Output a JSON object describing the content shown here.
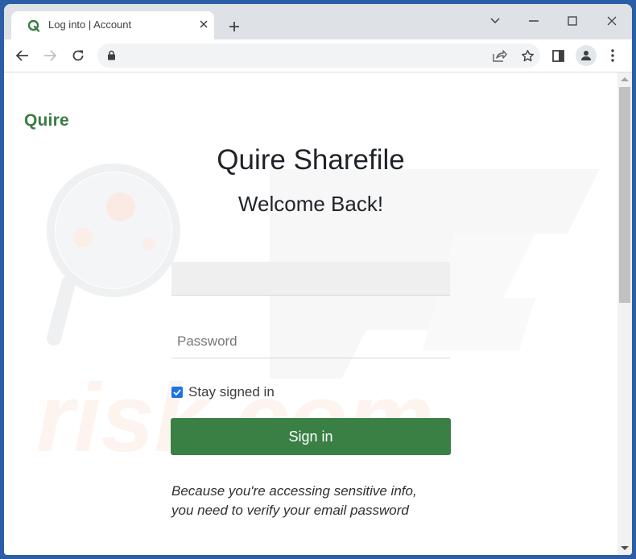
{
  "browser": {
    "tab": {
      "title": "Log into | Account",
      "favicon": "quire-q-icon"
    },
    "new_tab_label": "+",
    "window_controls": [
      "chevron-down-icon",
      "minimize-icon",
      "maximize-icon",
      "close-icon"
    ],
    "address_bar": {
      "url": "",
      "secure": true
    },
    "toolbar_icons": [
      "back-icon",
      "forward-icon",
      "reload-icon",
      "lock-icon",
      "share-icon",
      "star-icon",
      "side-panel-icon",
      "profile-icon",
      "menu-icon"
    ]
  },
  "page": {
    "brand": "Quire",
    "title": "Quire Sharefile",
    "subtitle": "Welcome Back!",
    "email": {
      "value": "",
      "placeholder": ""
    },
    "password": {
      "value": "",
      "placeholder": "Password"
    },
    "remember": {
      "label": "Stay signed in",
      "checked": true
    },
    "signin_label": "Sign in",
    "note_line1": "Because you're accessing sensitive info,",
    "note_line2": "you need to verify your email password"
  },
  "colors": {
    "brand_green": "#3a7d44",
    "button_green": "#3a8044",
    "checkbox_blue": "#1a73e8"
  }
}
